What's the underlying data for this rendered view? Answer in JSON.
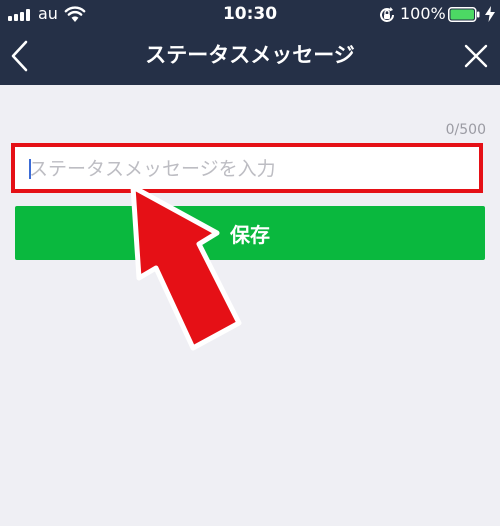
{
  "status_bar": {
    "carrier": "au",
    "time": "10:30",
    "battery_percent": "100%",
    "signal_icon": "signal-bars-icon",
    "wifi_icon": "wifi-icon",
    "rotation_lock_icon": "rotation-lock-icon",
    "battery_icon": "battery-icon",
    "charging_icon": "charging-bolt-icon"
  },
  "nav": {
    "title": "ステータスメッセージ",
    "back_icon": "chevron-left-icon",
    "close_icon": "close-icon"
  },
  "form": {
    "char_count": "0/500",
    "input_value": "",
    "input_placeholder": "ステータスメッセージを入力",
    "save_label": "保存"
  },
  "annotation": {
    "highlight_color": "#e51016",
    "arrow_icon": "red-arrow-pointer"
  },
  "colors": {
    "header_bg": "#253047",
    "save_button_bg": "#0ab83e",
    "page_bg": "#efeff4"
  }
}
